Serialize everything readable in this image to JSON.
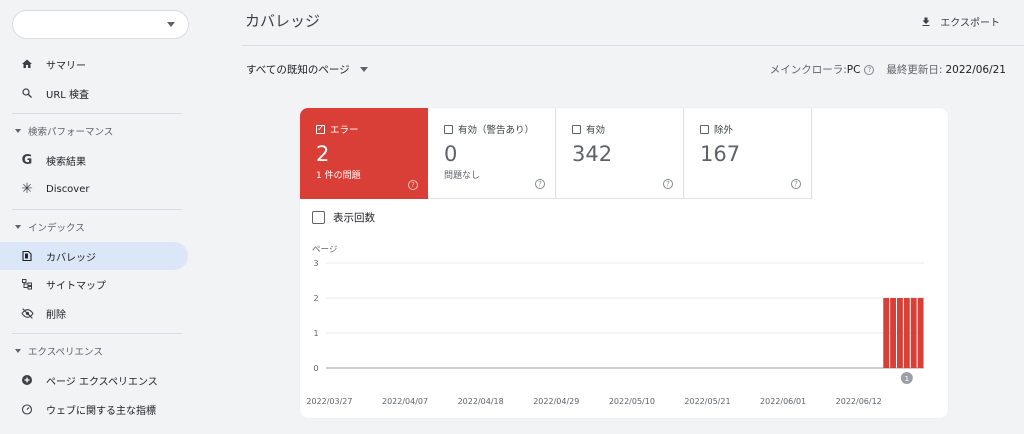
{
  "sidebar": {
    "property_value": "",
    "items_top": [
      {
        "icon": "home-icon",
        "label": "サマリー"
      },
      {
        "icon": "search-icon",
        "label": "URL 検査"
      }
    ],
    "sections": [
      {
        "title": "検索パフォーマンス",
        "items": [
          {
            "icon": "google-g-icon",
            "label": "検索結果"
          },
          {
            "icon": "asterisk-icon",
            "label": "Discover"
          }
        ]
      },
      {
        "title": "インデックス",
        "items": [
          {
            "icon": "coverage-icon",
            "label": "カバレッジ",
            "active": true
          },
          {
            "icon": "sitemap-icon",
            "label": "サイトマップ"
          },
          {
            "icon": "eye-off-icon",
            "label": "削除"
          }
        ]
      },
      {
        "title": "エクスペリエンス",
        "items": [
          {
            "icon": "plus-circle-icon",
            "label": "ページ エクスペリエンス"
          },
          {
            "icon": "gauge-icon",
            "label": "ウェブに関する主な指標"
          }
        ]
      }
    ]
  },
  "header": {
    "title": "カバレッジ",
    "export_label": "エクスポート",
    "filter_label": "すべての既知のページ",
    "crawler_label": "メインクローラ: ",
    "crawler_value": "PC",
    "updated_label": "最終更新日: ",
    "updated_value": "2022/06/21"
  },
  "tiles": [
    {
      "label": "エラー",
      "value": "2",
      "sub": "1 件の問題",
      "checked": true,
      "color": "#d93f37"
    },
    {
      "label": "有効（警告あり）",
      "value": "0",
      "sub": "問題なし",
      "checked": false
    },
    {
      "label": "有効",
      "value": "342",
      "sub": "",
      "checked": false
    },
    {
      "label": "除外",
      "value": "167",
      "sub": "",
      "checked": false
    }
  ],
  "impressions_label": "表示回数",
  "chart_data": {
    "type": "bar",
    "ylabel": "ページ",
    "ylim": [
      0,
      3
    ],
    "yticks": [
      "0",
      "1",
      "2",
      "3"
    ],
    "xtick_labels": [
      "2022/03/27",
      "2022/04/07",
      "2022/04/18",
      "2022/04/29",
      "2022/05/10",
      "2022/05/21",
      "2022/06/01",
      "2022/06/12"
    ],
    "x_start": "2022/03/27",
    "x_end": "2022/06/21",
    "series": [
      {
        "color": "#d93f37",
        "points": [
          {
            "x": "2022/06/16",
            "y": 2
          },
          {
            "x": "2022/06/17",
            "y": 2
          },
          {
            "x": "2022/06/18",
            "y": 2
          },
          {
            "x": "2022/06/19",
            "y": 2
          },
          {
            "x": "2022/06/20",
            "y": 2
          },
          {
            "x": "2022/06/21",
            "y": 2
          }
        ]
      }
    ],
    "annotations": [
      {
        "x": "2022/06/19",
        "label": "1"
      }
    ]
  }
}
